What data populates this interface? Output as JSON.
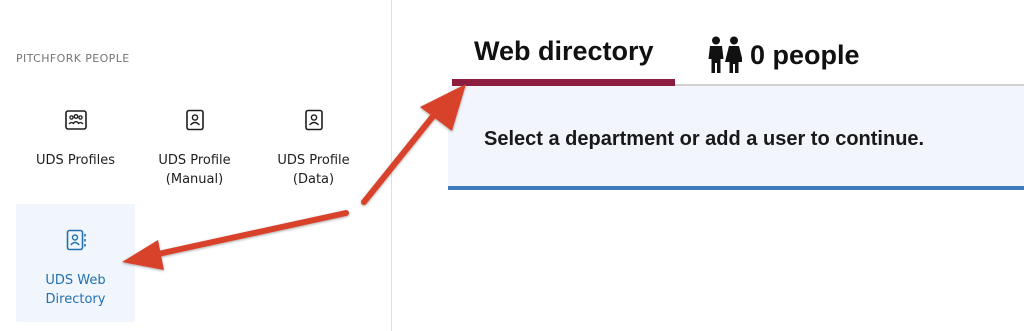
{
  "inserter": {
    "category_title": "PITCHFORK PEOPLE",
    "blocks": [
      {
        "label_line1": "UDS Profiles",
        "label_line2": "",
        "icon": "people-group-icon"
      },
      {
        "label_line1": "UDS Profile",
        "label_line2": "(Manual)",
        "icon": "person-badge-icon"
      },
      {
        "label_line1": "UDS Profile",
        "label_line2": "(Data)",
        "icon": "person-badge-icon"
      },
      {
        "label_line1": "UDS Web",
        "label_line2": "Directory",
        "icon": "contact-book-icon",
        "selected": true
      }
    ]
  },
  "directory": {
    "tabs": [
      {
        "label": "Web directory",
        "active": true
      },
      {
        "label": "0 people",
        "icon": "people-icon"
      }
    ],
    "notice": "Select a department or add a user to continue."
  },
  "colors": {
    "tab_accent": "#8c1d40",
    "notice_border": "#3d7bbd",
    "selected_bg": "#f0f6fc",
    "selected_text": "#2271b1",
    "annotation_arrow": "#d9432b"
  }
}
